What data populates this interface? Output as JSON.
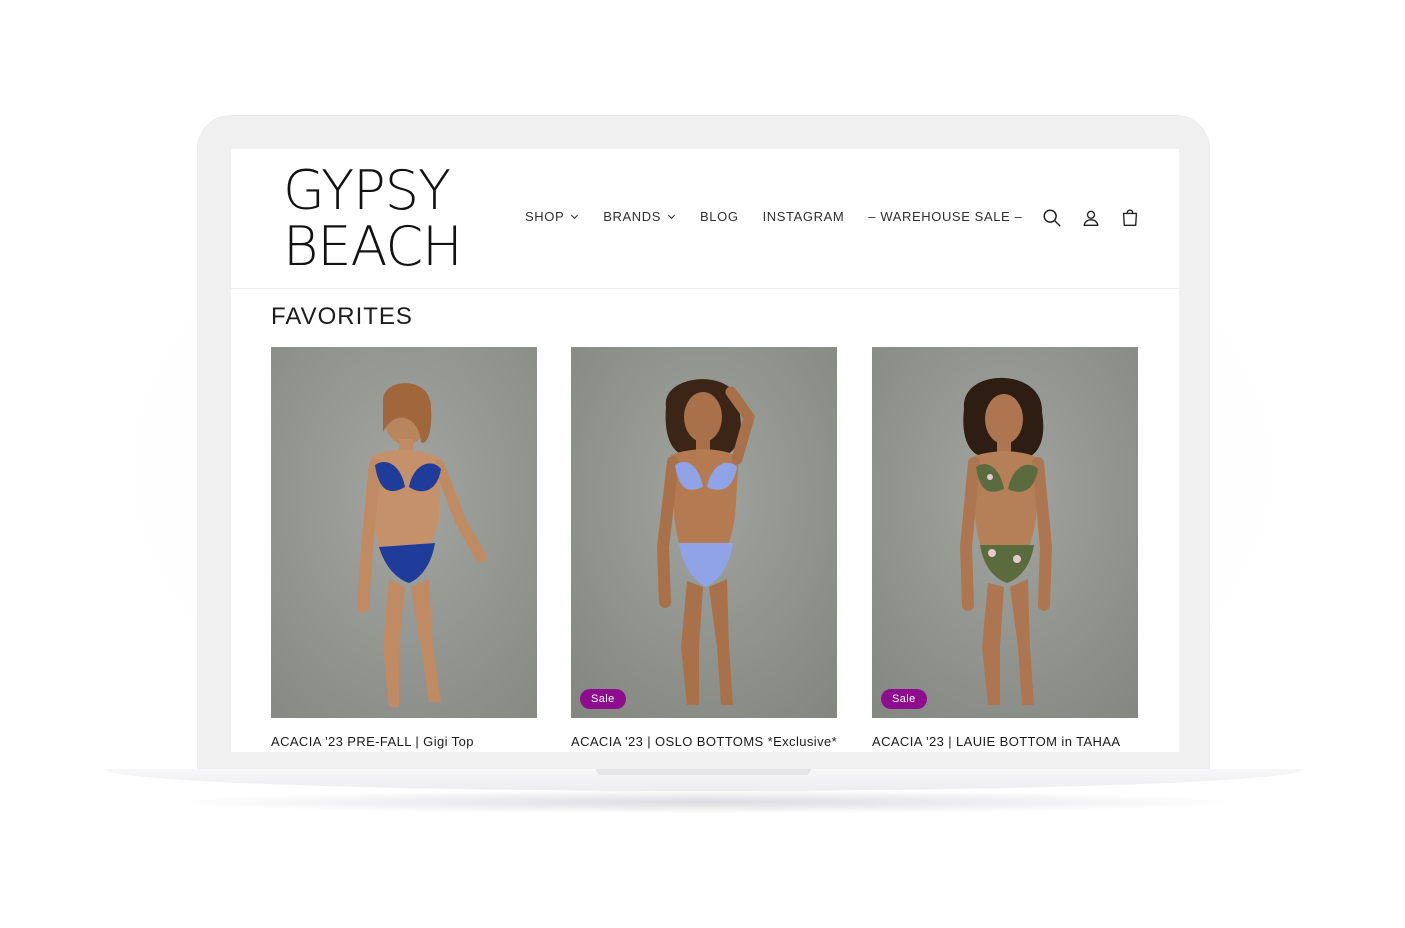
{
  "brand": {
    "logo_line1": "GYPSY",
    "logo_line2": "BEACH"
  },
  "nav": {
    "items": [
      {
        "label": "SHOP",
        "has_dropdown": true
      },
      {
        "label": "BRANDS",
        "has_dropdown": true
      },
      {
        "label": "BLOG",
        "has_dropdown": false
      },
      {
        "label": "INSTAGRAM",
        "has_dropdown": false
      },
      {
        "label": "– WAREHOUSE SALE –",
        "has_dropdown": false
      }
    ]
  },
  "header_icons": [
    "search-icon",
    "account-icon",
    "cart-icon"
  ],
  "section": {
    "title": "FAVORITES"
  },
  "products": [
    {
      "title": "ACACIA '23 PRE-FALL | Gigi Top",
      "badge": "",
      "swimsuit_color": "#1f3c9a"
    },
    {
      "title": "ACACIA '23 | OSLO BOTTOMS *Exclusive*",
      "badge": "Sale",
      "swimsuit_color": "#8fa3e6"
    },
    {
      "title": "ACACIA '23 | LAUIE BOTTOM in TAHAA",
      "badge": "Sale",
      "swimsuit_color": "#5a6b3e"
    }
  ],
  "colors": {
    "sale_badge": "#8e0c8e",
    "photo_background": "#9a9d98",
    "text": "#1a1a1a"
  }
}
